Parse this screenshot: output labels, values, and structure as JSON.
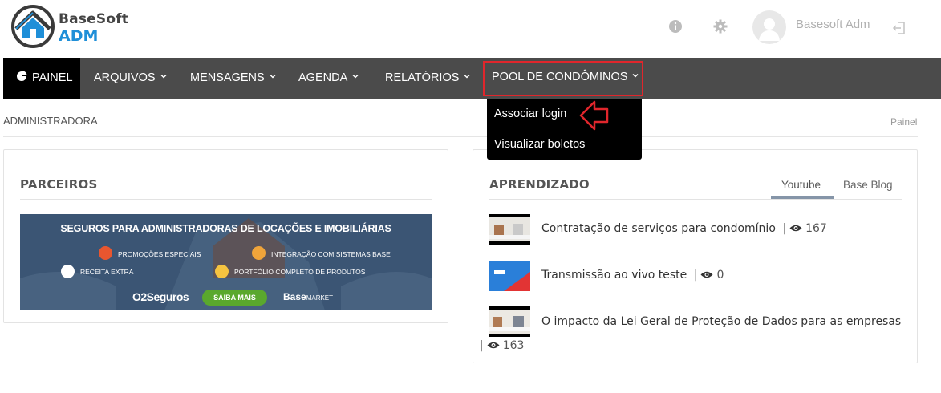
{
  "brand": {
    "line1": "BaseSoft",
    "line2": "ADM",
    "accent": "#1f8fd8"
  },
  "user": {
    "name": "Basesoft Adm"
  },
  "nav": {
    "background": "#4b4b4b",
    "items": [
      {
        "label": "PAINEL"
      },
      {
        "label": "ARQUIVOS"
      },
      {
        "label": "MENSAGENS"
      },
      {
        "label": "AGENDA"
      },
      {
        "label": "RELATÓRIOS"
      },
      {
        "label": "POOL DE CONDÔMINOS"
      }
    ],
    "dropdown": [
      {
        "label": "Associar login"
      },
      {
        "label": "Visualizar boletos"
      }
    ],
    "highlight_color": "#e0262c"
  },
  "breadcrumb": {
    "left": "ADMINISTRADORA",
    "right": "Painel"
  },
  "parceiros": {
    "title": "PARCEIROS",
    "banner": {
      "title": "SEGUROS PARA ADMINISTRADORAS DE LOCAÇÕES E IMOBILIÁRIAS",
      "features": [
        "PROMOÇÕES ESPECIAIS",
        "INTEGRAÇÃO COM SISTEMAS BASE",
        "RECEITA EXTRA",
        "PORTFÓLIO COMPLETO DE PRODUTOS"
      ],
      "logo1": "O2Seguros",
      "cta": "SAIBA MAIS",
      "logo2_bold": "Base",
      "logo2_rest": "MARKET"
    }
  },
  "aprendizado": {
    "title": "APRENDIZADO",
    "tabs": [
      {
        "label": "Youtube",
        "active": true
      },
      {
        "label": "Base Blog",
        "active": false
      }
    ],
    "videos": [
      {
        "title": "Contratação de serviços para condomínio",
        "views": "167"
      },
      {
        "title": "Transmissão ao vivo teste",
        "views": "0"
      },
      {
        "title": "O impacto da Lei Geral de Proteção de Dados para as empresas",
        "views": "163"
      }
    ]
  }
}
